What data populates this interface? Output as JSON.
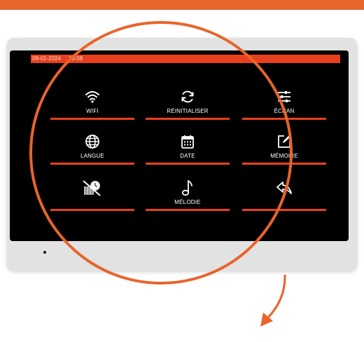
{
  "status_bar": {
    "date": "09-01-2024",
    "time": "19:08"
  },
  "menu": [
    {
      "id": "wifi",
      "label": "WIFI",
      "icon": "wifi-icon"
    },
    {
      "id": "reset",
      "label": "RÉINITIALISER",
      "icon": "refresh-icon"
    },
    {
      "id": "screen",
      "label": "ÉCRAN",
      "icon": "sliders-icon"
    },
    {
      "id": "language",
      "label": "LANGUE",
      "icon": "globe-icon"
    },
    {
      "id": "date",
      "label": "DATE",
      "icon": "calendar-icon"
    },
    {
      "id": "memory",
      "label": "MÉMOIRE",
      "icon": "edit-icon"
    },
    {
      "id": "schedule",
      "label": "",
      "icon": "clock-crossed-icon"
    },
    {
      "id": "melody",
      "label": "MÉLODIE",
      "icon": "music-note-icon"
    },
    {
      "id": "back",
      "label": "",
      "icon": "back-arrow-icon"
    }
  ],
  "colors": {
    "accent": "#e8401f",
    "highlight": "#e8642b",
    "screen_bg": "#000000",
    "frame": "#e2e2e2"
  }
}
